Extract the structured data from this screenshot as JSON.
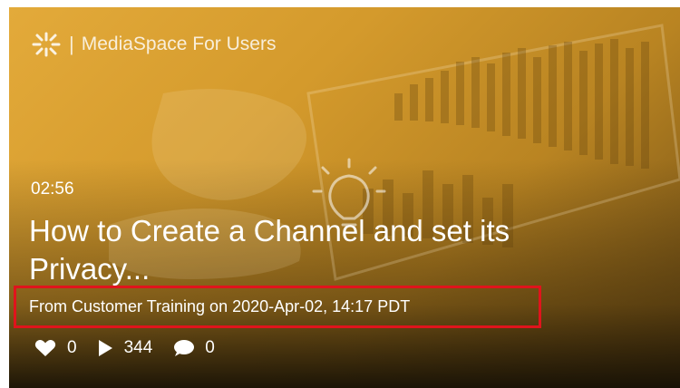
{
  "brand": {
    "separator": "|",
    "name": "MediaSpace For Users"
  },
  "video": {
    "duration": "02:56",
    "title_line1": "How to Create a Channel and set its",
    "title_line2": "Privacy...",
    "meta": "From Customer Training on 2020-Apr-02, 14:17 PDT"
  },
  "stats": {
    "likes": "0",
    "plays": "344",
    "comments": "0"
  },
  "colors": {
    "overlay": "#d49a2c",
    "highlight_border": "#e0141c",
    "text": "#ffffff"
  },
  "icons": [
    "kaltura-logo-icon",
    "heart-icon",
    "play-icon",
    "comment-icon",
    "lightbulb-icon"
  ]
}
